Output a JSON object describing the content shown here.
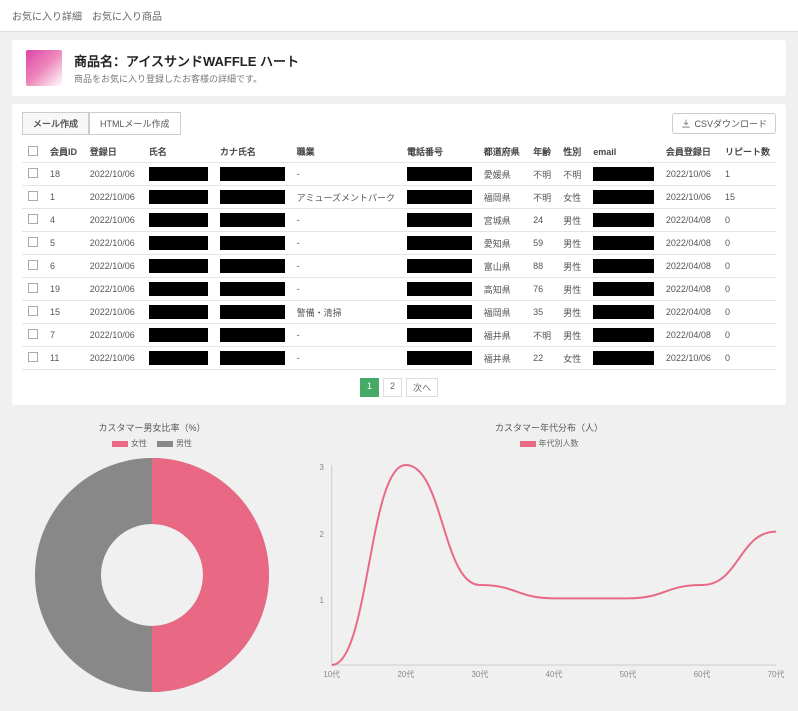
{
  "header": {
    "title": "お気に入り詳細",
    "sub": "お気に入り商品"
  },
  "product": {
    "prefix": "商品名：",
    "name": "アイスサンドWAFFLE ハート",
    "desc": "商品をお気に入り登録したお客様の詳細です。"
  },
  "tabs": [
    {
      "label": "メール作成"
    },
    {
      "label": "HTMLメール作成"
    }
  ],
  "download": "CSVダウンロード",
  "columns": [
    "",
    "会員ID",
    "登録日",
    "氏名",
    "カナ氏名",
    "職業",
    "電話番号",
    "都道府県",
    "年齢",
    "性別",
    "email",
    "会員登録日",
    "リピート数"
  ],
  "rows": [
    {
      "id": "18",
      "date": "2022/10/06",
      "job": "-",
      "pref": "愛媛県",
      "age": "不明",
      "sex": "不明",
      "reg": "2022/10/06",
      "rep": "1"
    },
    {
      "id": "1",
      "date": "2022/10/06",
      "job": "アミューズメントパーク",
      "pref": "福岡県",
      "age": "不明",
      "sex": "女性",
      "reg": "2022/10/06",
      "rep": "15"
    },
    {
      "id": "4",
      "date": "2022/10/06",
      "job": "-",
      "pref": "宮城県",
      "age": "24",
      "sex": "男性",
      "reg": "2022/04/08",
      "rep": "0"
    },
    {
      "id": "5",
      "date": "2022/10/06",
      "job": "-",
      "pref": "愛知県",
      "age": "59",
      "sex": "男性",
      "reg": "2022/04/08",
      "rep": "0"
    },
    {
      "id": "6",
      "date": "2022/10/06",
      "job": "-",
      "pref": "富山県",
      "age": "88",
      "sex": "男性",
      "reg": "2022/04/08",
      "rep": "0"
    },
    {
      "id": "19",
      "date": "2022/10/06",
      "job": "-",
      "pref": "高知県",
      "age": "76",
      "sex": "男性",
      "reg": "2022/04/08",
      "rep": "0"
    },
    {
      "id": "15",
      "date": "2022/10/06",
      "job": "警備・清掃",
      "pref": "福岡県",
      "age": "35",
      "sex": "男性",
      "reg": "2022/04/08",
      "rep": "0"
    },
    {
      "id": "7",
      "date": "2022/10/06",
      "job": "-",
      "pref": "福井県",
      "age": "不明",
      "sex": "男性",
      "reg": "2022/04/08",
      "rep": "0"
    },
    {
      "id": "11",
      "date": "2022/10/06",
      "job": "-",
      "pref": "福井県",
      "age": "22",
      "sex": "女性",
      "reg": "2022/10/06",
      "rep": "0"
    }
  ],
  "pagination": {
    "pages": [
      "1",
      "2"
    ],
    "next": "次へ"
  },
  "donut": {
    "title": "カスタマー男女比率（%）",
    "legend": [
      {
        "label": "女性",
        "color": "#e96985"
      },
      {
        "label": "男性",
        "color": "#888888"
      }
    ]
  },
  "line": {
    "title": "カスタマー年代分布（人）",
    "legend": [
      {
        "label": "年代別人数",
        "color": "#e96985"
      }
    ],
    "xlabels": [
      "10代",
      "20代",
      "30代",
      "40代",
      "50代",
      "60代",
      "70代"
    ]
  },
  "chart_data": [
    {
      "type": "pie",
      "title": "カスタマー男女比率（%）",
      "series": [
        {
          "name": "女性",
          "value": 50
        },
        {
          "name": "男性",
          "value": 50
        }
      ]
    },
    {
      "type": "line",
      "title": "カスタマー年代分布（人）",
      "categories": [
        "10代",
        "20代",
        "30代",
        "40代",
        "50代",
        "60代",
        "70代"
      ],
      "values": [
        0,
        3,
        1.2,
        1,
        1,
        1.2,
        2
      ],
      "ylim": [
        0,
        3
      ]
    }
  ]
}
